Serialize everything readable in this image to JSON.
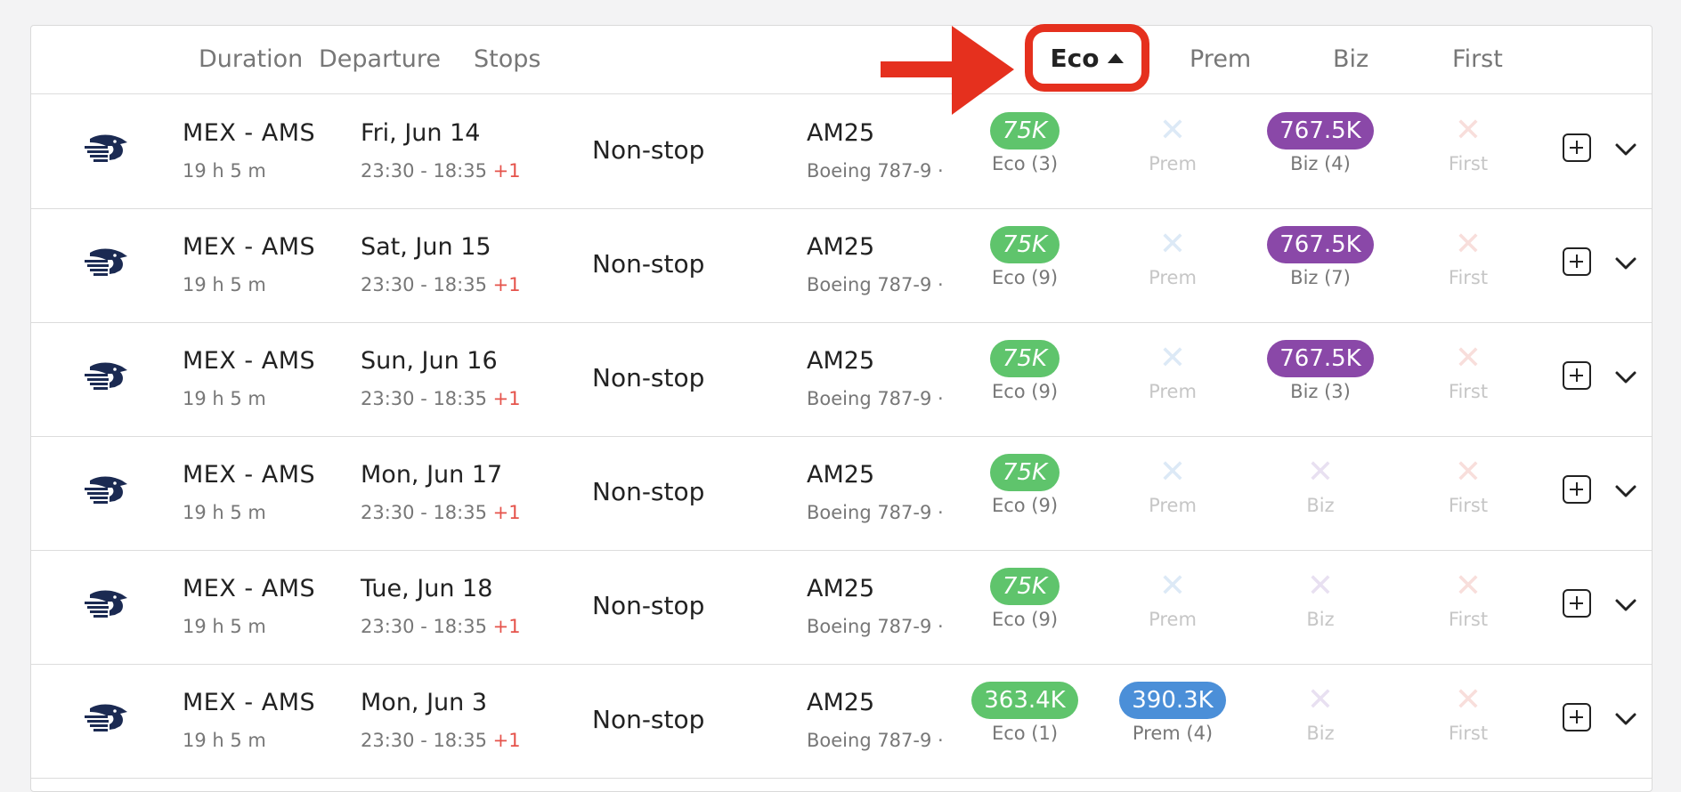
{
  "header": {
    "duration": "Duration",
    "departure": "Departure",
    "stops": "Stops",
    "sort_label": "Eco",
    "prem": "Prem",
    "biz": "Biz",
    "first": "First"
  },
  "colors": {
    "eco": "#5fc46c",
    "biz": "#8a48a8",
    "prem": "#4b8fd8",
    "highlight": "#e5301e"
  },
  "icons": {
    "airline_logo": "aeromexico-eagle-icon",
    "add": "plus-square-icon",
    "expand": "chevron-down-icon",
    "unavailable": "x-icon",
    "sort": "caret-up-icon"
  },
  "rows": [
    {
      "route": "MEX - AMS",
      "duration": "19 h 5 m",
      "date": "Fri, Jun 14",
      "times": "23:30 - 18:35",
      "plus_day": "+1",
      "stops": "Non-stop",
      "flight": "AM25",
      "aircraft": "Boeing 787-9 ·",
      "eco": {
        "price": "75K",
        "label": "Eco (3)"
      },
      "prem": {
        "price": "",
        "label": "Prem"
      },
      "biz": {
        "price": "767.5K",
        "label": "Biz (4)"
      },
      "first": {
        "price": "",
        "label": "First"
      }
    },
    {
      "route": "MEX - AMS",
      "duration": "19 h 5 m",
      "date": "Sat, Jun 15",
      "times": "23:30 - 18:35",
      "plus_day": "+1",
      "stops": "Non-stop",
      "flight": "AM25",
      "aircraft": "Boeing 787-9 ·",
      "eco": {
        "price": "75K",
        "label": "Eco (9)"
      },
      "prem": {
        "price": "",
        "label": "Prem"
      },
      "biz": {
        "price": "767.5K",
        "label": "Biz (7)"
      },
      "first": {
        "price": "",
        "label": "First"
      }
    },
    {
      "route": "MEX - AMS",
      "duration": "19 h 5 m",
      "date": "Sun, Jun 16",
      "times": "23:30 - 18:35",
      "plus_day": "+1",
      "stops": "Non-stop",
      "flight": "AM25",
      "aircraft": "Boeing 787-9 ·",
      "eco": {
        "price": "75K",
        "label": "Eco (9)"
      },
      "prem": {
        "price": "",
        "label": "Prem"
      },
      "biz": {
        "price": "767.5K",
        "label": "Biz (3)"
      },
      "first": {
        "price": "",
        "label": "First"
      }
    },
    {
      "route": "MEX - AMS",
      "duration": "19 h 5 m",
      "date": "Mon, Jun 17",
      "times": "23:30 - 18:35",
      "plus_day": "+1",
      "stops": "Non-stop",
      "flight": "AM25",
      "aircraft": "Boeing 787-9 ·",
      "eco": {
        "price": "75K",
        "label": "Eco (9)"
      },
      "prem": {
        "price": "",
        "label": "Prem"
      },
      "biz": {
        "price": "",
        "label": "Biz"
      },
      "first": {
        "price": "",
        "label": "First"
      }
    },
    {
      "route": "MEX - AMS",
      "duration": "19 h 5 m",
      "date": "Tue, Jun 18",
      "times": "23:30 - 18:35",
      "plus_day": "+1",
      "stops": "Non-stop",
      "flight": "AM25",
      "aircraft": "Boeing 787-9 ·",
      "eco": {
        "price": "75K",
        "label": "Eco (9)"
      },
      "prem": {
        "price": "",
        "label": "Prem"
      },
      "biz": {
        "price": "",
        "label": "Biz"
      },
      "first": {
        "price": "",
        "label": "First"
      }
    },
    {
      "route": "MEX - AMS",
      "duration": "19 h 5 m",
      "date": "Mon, Jun 3",
      "times": "23:30 - 18:35",
      "plus_day": "+1",
      "stops": "Non-stop",
      "flight": "AM25",
      "aircraft": "Boeing 787-9 ·",
      "eco": {
        "price": "363.4K",
        "label": "Eco (1)"
      },
      "prem": {
        "price": "390.3K",
        "label": "Prem (4)"
      },
      "biz": {
        "price": "",
        "label": "Biz"
      },
      "first": {
        "price": "",
        "label": "First"
      }
    }
  ]
}
